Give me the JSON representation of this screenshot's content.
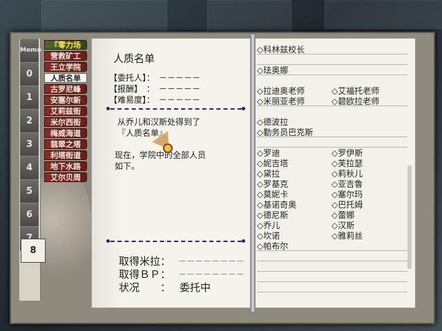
{
  "tabs": [
    {
      "label": "『零力场",
      "style": "green"
    },
    {
      "label": "营救矿工",
      "style": "red"
    },
    {
      "label": "王立学院",
      "style": "red"
    },
    {
      "label": "人质名单",
      "style": "white"
    },
    {
      "label": "古罗尼峰",
      "style": "red"
    },
    {
      "label": "安塞尔新",
      "style": "red"
    },
    {
      "label": "艾莉兹街",
      "style": "red"
    },
    {
      "label": "米尔西街",
      "style": "red"
    },
    {
      "label": "梅威海道",
      "style": "red"
    },
    {
      "label": "翡翠之塔",
      "style": "red"
    },
    {
      "label": "利塔街道",
      "style": "red"
    },
    {
      "label": "地下水路",
      "style": "red"
    },
    {
      "label": "艾尔贝周",
      "style": "red"
    }
  ],
  "sidebar": {
    "top_label": "Memo",
    "chapters": [
      "0",
      "1",
      "2",
      "3",
      "4",
      "5",
      "6",
      "7",
      "8"
    ],
    "active_chapter": "8"
  },
  "left_page": {
    "title": "人质名单",
    "client_label": "【委托人】：",
    "client_value": "－－－－－",
    "reward_label": "【报酬】　：",
    "reward_value": "－－－－－",
    "difficulty_label": "【难易度】：",
    "difficulty_value": "－－－－－",
    "desc_line1": "从乔儿和汉斯处得到了",
    "desc_line2": "『人质名单』。",
    "desc_line3": "现在，学院中的全部人员",
    "desc_line4": "如下。",
    "mira_label": "取得米拉：",
    "mira_value": "－－－－－－－－",
    "bp_label": "取得ＢＰ：",
    "bp_value": "－－－－－－－－",
    "status_label": "状况　　：",
    "status_value": "委托中"
  },
  "right_page": {
    "entries_single": [
      "◇科林兹校长",
      "◇珐奥娜"
    ],
    "teachers_left": [
      "◇拉迪奥老师",
      "◇米丽亚老师"
    ],
    "teachers_right": [
      "◇艾福托老师",
      "◇碧欧拉老师"
    ],
    "staff": [
      "◇德波拉",
      "◇勤务员巴克斯"
    ],
    "students_left": [
      "◇罗迪",
      "◇妮吉塔",
      "◇黛拉",
      "◇罗基克",
      "◇莫妮卡",
      "◇基诺奇奥",
      "◇德尼斯",
      "◇乔儿",
      "◇坎诺",
      "◇帕布尔"
    ],
    "students_right": [
      "◇罗伊斯",
      "◇芙拉瑟",
      "◇莉秋儿",
      "◇亚吉鲁",
      "◇塞尔玛",
      "◇巴托姆",
      "◇蕾娜",
      "◇汉斯",
      "◇雅莉丝"
    ]
  },
  "colors": {
    "divider": "#1d2a6a",
    "tab_red": "#8c2a22",
    "tab_green": "#4b6a2a",
    "page": "#f3f1ea"
  }
}
